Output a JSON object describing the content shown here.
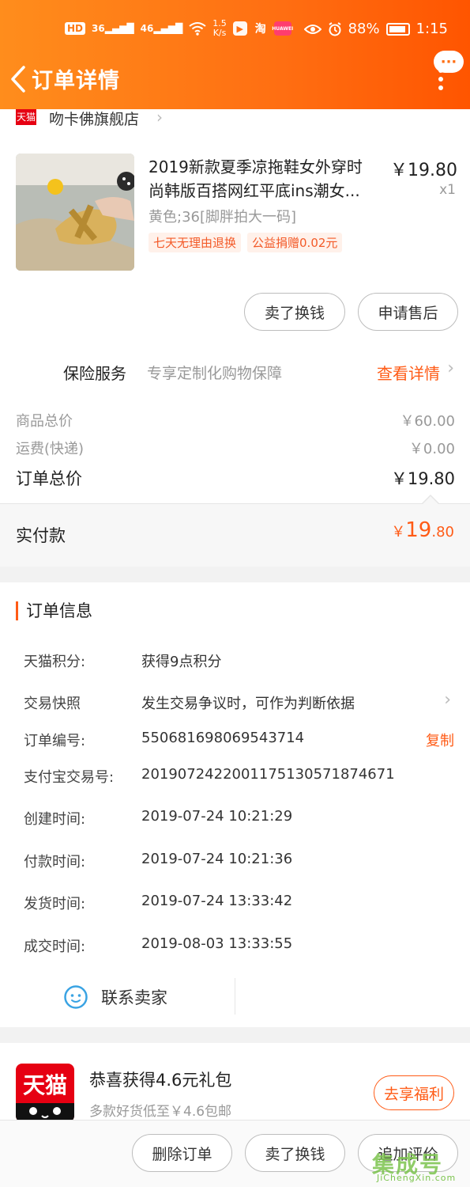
{
  "status_bar": {
    "hd_label": "HD",
    "signal_1": "36",
    "signal_2": "46",
    "speed": "1.5\nK/s",
    "app_1": "▶",
    "app_2": "淘",
    "app_3": "HUAWEI",
    "battery_percent": "88%",
    "time": "1:15"
  },
  "header": {
    "title": "订单详情",
    "more_label": "···"
  },
  "store": {
    "badge": "天猫",
    "name": "吻卡佛旗舰店"
  },
  "product": {
    "title_line1": "2019新款夏季凉拖鞋女外穿时",
    "title_line2": "尚韩版百搭网红平底ins潮女...",
    "price": "￥19.80",
    "quantity": "x1",
    "sku": "黄色;36[脚胖拍大一码]",
    "tags": [
      "七天无理由退换",
      "公益捐赠0.02元"
    ]
  },
  "actions": {
    "sell_for_cash": "卖了换钱",
    "after_sale": "申请售后"
  },
  "insurance": {
    "label": "保险服务",
    "description": "专享定制化购物保障",
    "link": "查看详情"
  },
  "totals": {
    "goods_label": "商品总价",
    "goods_value": "￥60.00",
    "shipping_label": "运费(快递)",
    "shipping_value": "￥0.00",
    "order_label": "订单总价",
    "order_value": "￥19.80",
    "paid_label": "实付款",
    "paid_symbol": "￥",
    "paid_int": "19",
    "paid_dec": ".80"
  },
  "order_info": {
    "heading": "订单信息",
    "points_label": "天猫积分:",
    "points_value": "获得9点积分",
    "snapshot_label": "交易快照",
    "snapshot_value": "发生交易争议时，可作为判断依据",
    "order_no_label": "订单编号:",
    "order_no_value": "550681698069543714",
    "copy_label": "复制",
    "alipay_label": "支付宝交易号:",
    "alipay_value": "2019072422001175130571874671",
    "created_label": "创建时间:",
    "created_value": "2019-07-24 10:21:29",
    "paid_label": "付款时间:",
    "paid_value": "2019-07-24 10:21:36",
    "shipped_label": "发货时间:",
    "shipped_value": "2019-07-24 13:33:42",
    "completed_label": "成交时间:",
    "completed_value": "2019-08-03 13:33:55",
    "contact_seller": "联系卖家"
  },
  "promo": {
    "logo_text": "天猫",
    "title": "恭喜获得4.6元礼包",
    "subtitle": "多款好货低至￥4.6包邮",
    "button": "去享福利"
  },
  "bottom_bar": {
    "delete_order": "删除订单",
    "sell_for_cash": "卖了换钱",
    "add_review": "追加评价"
  },
  "watermark": {
    "main": "集成号",
    "sub": "JiChengXin.com"
  },
  "colors": {
    "brand_orange": "#ff6e12",
    "accent_red_orange": "#ff5b16",
    "tmall_red": "#e60012"
  }
}
